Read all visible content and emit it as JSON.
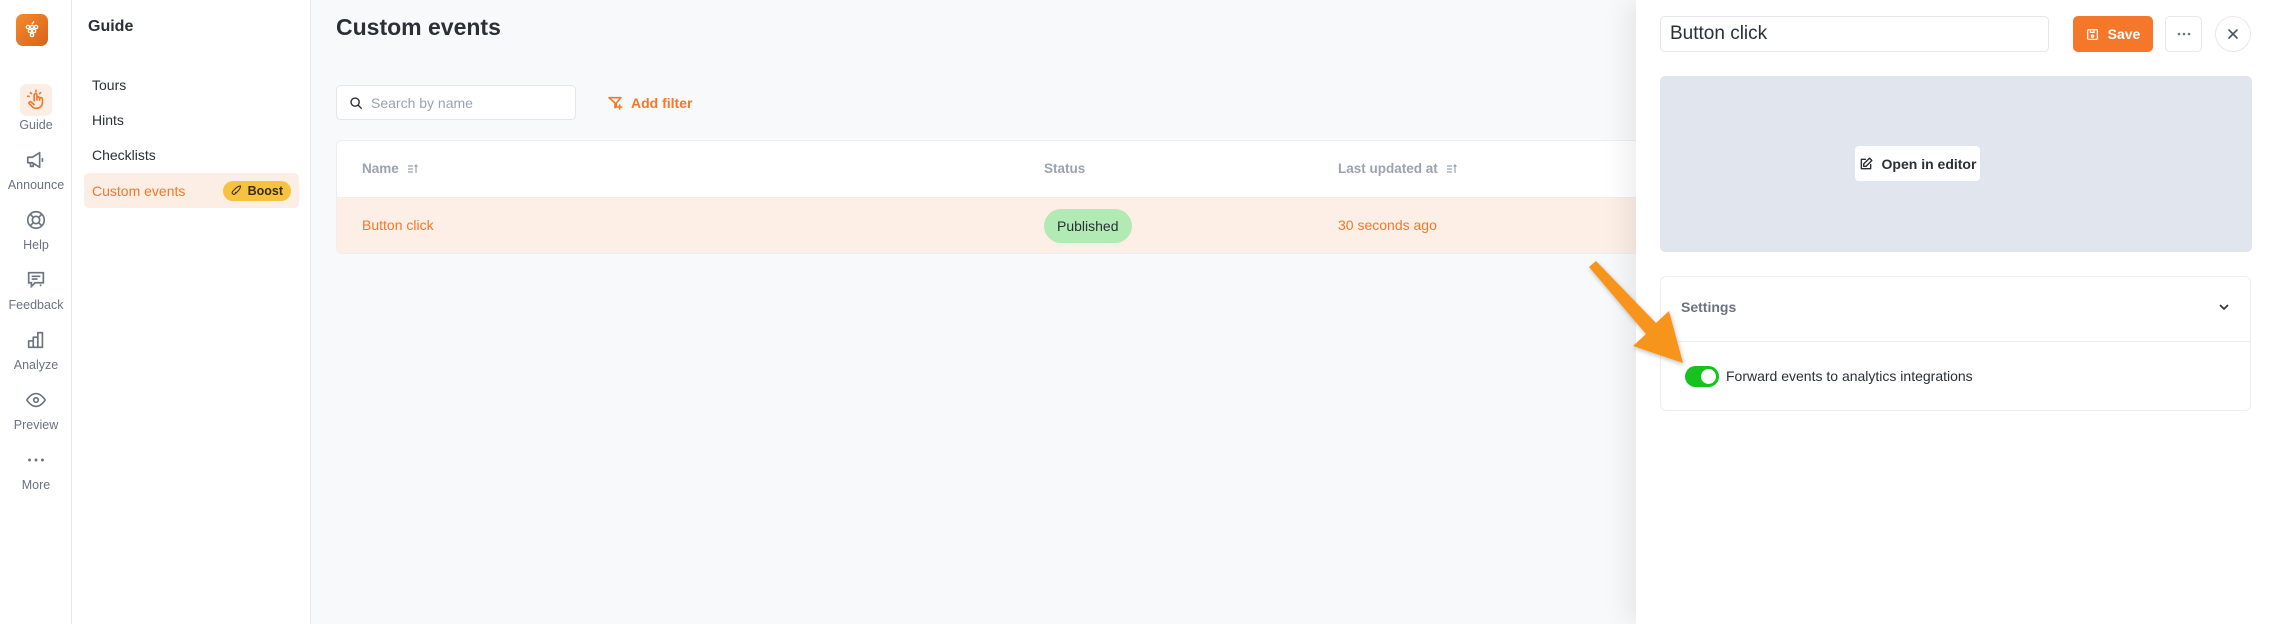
{
  "rail": {
    "items": [
      {
        "label": "Guide",
        "icon": "hand-pointer-icon",
        "active": true
      },
      {
        "label": "Announce",
        "icon": "megaphone-icon"
      },
      {
        "label": "Help",
        "icon": "lifebuoy-icon"
      },
      {
        "label": "Feedback",
        "icon": "feedback-icon"
      },
      {
        "label": "Analyze",
        "icon": "bar-chart-icon"
      },
      {
        "label": "Preview",
        "icon": "eye-icon"
      },
      {
        "label": "More",
        "icon": "more-dots-icon"
      }
    ]
  },
  "nav": {
    "title": "Guide",
    "items": [
      {
        "label": "Tours"
      },
      {
        "label": "Hints"
      },
      {
        "label": "Checklists"
      },
      {
        "label": "Custom events",
        "active": true,
        "badge": "Boost"
      }
    ]
  },
  "main": {
    "title": "Custom events",
    "search_placeholder": "Search by name",
    "search_value": "",
    "add_filter_label": "Add filter",
    "table": {
      "columns": [
        "Name",
        "Status",
        "Last updated at"
      ],
      "rows": [
        {
          "name": "Button click",
          "status": "Published",
          "updated": "30 seconds ago"
        }
      ]
    }
  },
  "panel": {
    "name_value": "Button click",
    "save_label": "Save",
    "open_editor_label": "Open in editor",
    "settings_title": "Settings",
    "toggle_label": "Forward events to analytics integrations",
    "toggle_on": true
  },
  "colors": {
    "accent": "#f5772a",
    "published": "#b2eab4",
    "toggle_on": "#16c21d",
    "annotation_arrow": "#f7941d"
  }
}
